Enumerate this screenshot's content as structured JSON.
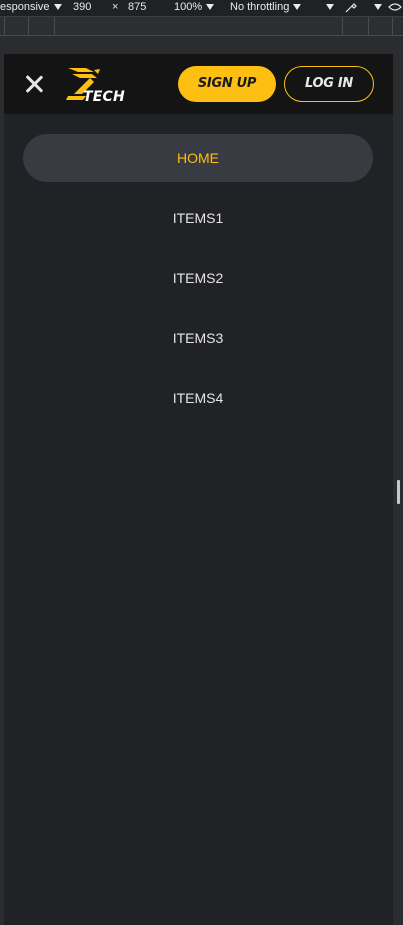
{
  "devtools": {
    "device": "esponsive",
    "width": "390",
    "times": "×",
    "height": "875",
    "zoom": "100%",
    "throttling": "No throttling"
  },
  "header": {
    "logo_text": "TECH",
    "signup_label": "SIGN UP",
    "login_label": "LOG IN"
  },
  "menu": {
    "items": [
      {
        "label": "HOME",
        "active": true
      },
      {
        "label": "ITEMS1",
        "active": false
      },
      {
        "label": "ITEMS2",
        "active": false
      },
      {
        "label": "ITEMS3",
        "active": false
      },
      {
        "label": "ITEMS4",
        "active": false
      }
    ]
  },
  "colors": {
    "accent": "#fdbf12",
    "header_bg": "#141414",
    "panel_bg": "#212225",
    "active_item_bg": "#393b42"
  }
}
